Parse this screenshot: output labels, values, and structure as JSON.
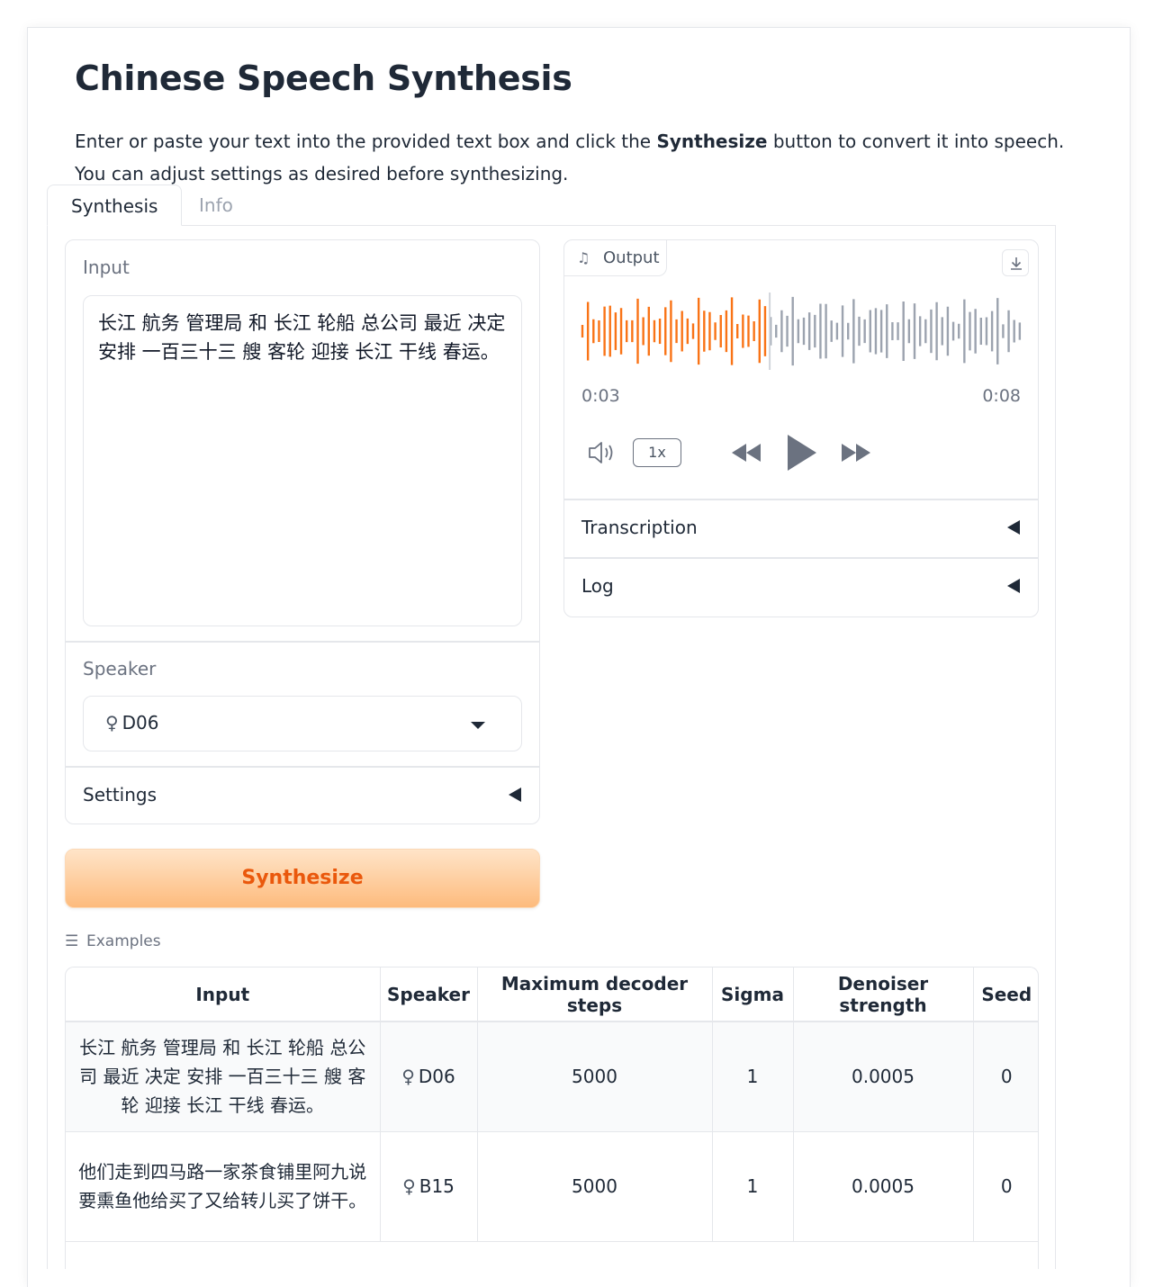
{
  "app": {
    "title": "Chinese Speech Synthesis",
    "desc_before": "Enter or paste your text into the provided text box and click the ",
    "desc_bold": "Synthesize",
    "desc_after": " button to convert it into speech. You can adjust settings as desired before synthesizing."
  },
  "tabs": [
    {
      "label": "Synthesis",
      "active": true
    },
    {
      "label": "Info",
      "active": false
    }
  ],
  "input": {
    "label": "Input",
    "value": "长江 航务 管理局 和 长江 轮船 总公司 最近 决定 安排 一百三十三 艘 客轮 迎接 长江 干线 春运。"
  },
  "speaker": {
    "label": "Speaker",
    "symbol": "♀",
    "value": "D06"
  },
  "settings": {
    "label": "Settings"
  },
  "synthesize_button": {
    "label": "Synthesize"
  },
  "output": {
    "label": "Output",
    "current_time": "0:03",
    "total_time": "0:08",
    "playback_rate": "1x",
    "progress": 0.42,
    "played_color": "#f97316",
    "unplayed_color": "#9ca3af",
    "icons": [
      "music-note-icon",
      "download-icon",
      "volume-icon",
      "rewind-icon",
      "play-icon",
      "fast-forward-icon"
    ]
  },
  "transcription": {
    "label": "Transcription"
  },
  "log": {
    "label": "Log"
  },
  "examples": {
    "label": "Examples",
    "columns": [
      "Input",
      "Speaker",
      "Maximum decoder steps",
      "Sigma",
      "Denoiser strength",
      "Seed"
    ],
    "rows": [
      {
        "input": "长江 航务 管理局 和 长江 轮船 总公司 最近 决定 安排 一百三十三 艘 客轮 迎接 长江 干线 春运。",
        "speaker_symbol": "♀",
        "speaker": "D06",
        "max_steps": "5000",
        "sigma": "1",
        "denoiser": "0.0005",
        "seed": "0"
      },
      {
        "input": "他们走到四马路一家茶食铺里阿九说要熏鱼他给买了又给转儿买了饼干。",
        "speaker_symbol": "♀",
        "speaker": "B15",
        "max_steps": "5000",
        "sigma": "1",
        "denoiser": "0.0005",
        "seed": "0"
      }
    ]
  },
  "colors": {
    "accent": "#ea580c",
    "button_gradient_top": "#ffe4c8",
    "button_gradient_bottom": "#fdbb7d"
  }
}
